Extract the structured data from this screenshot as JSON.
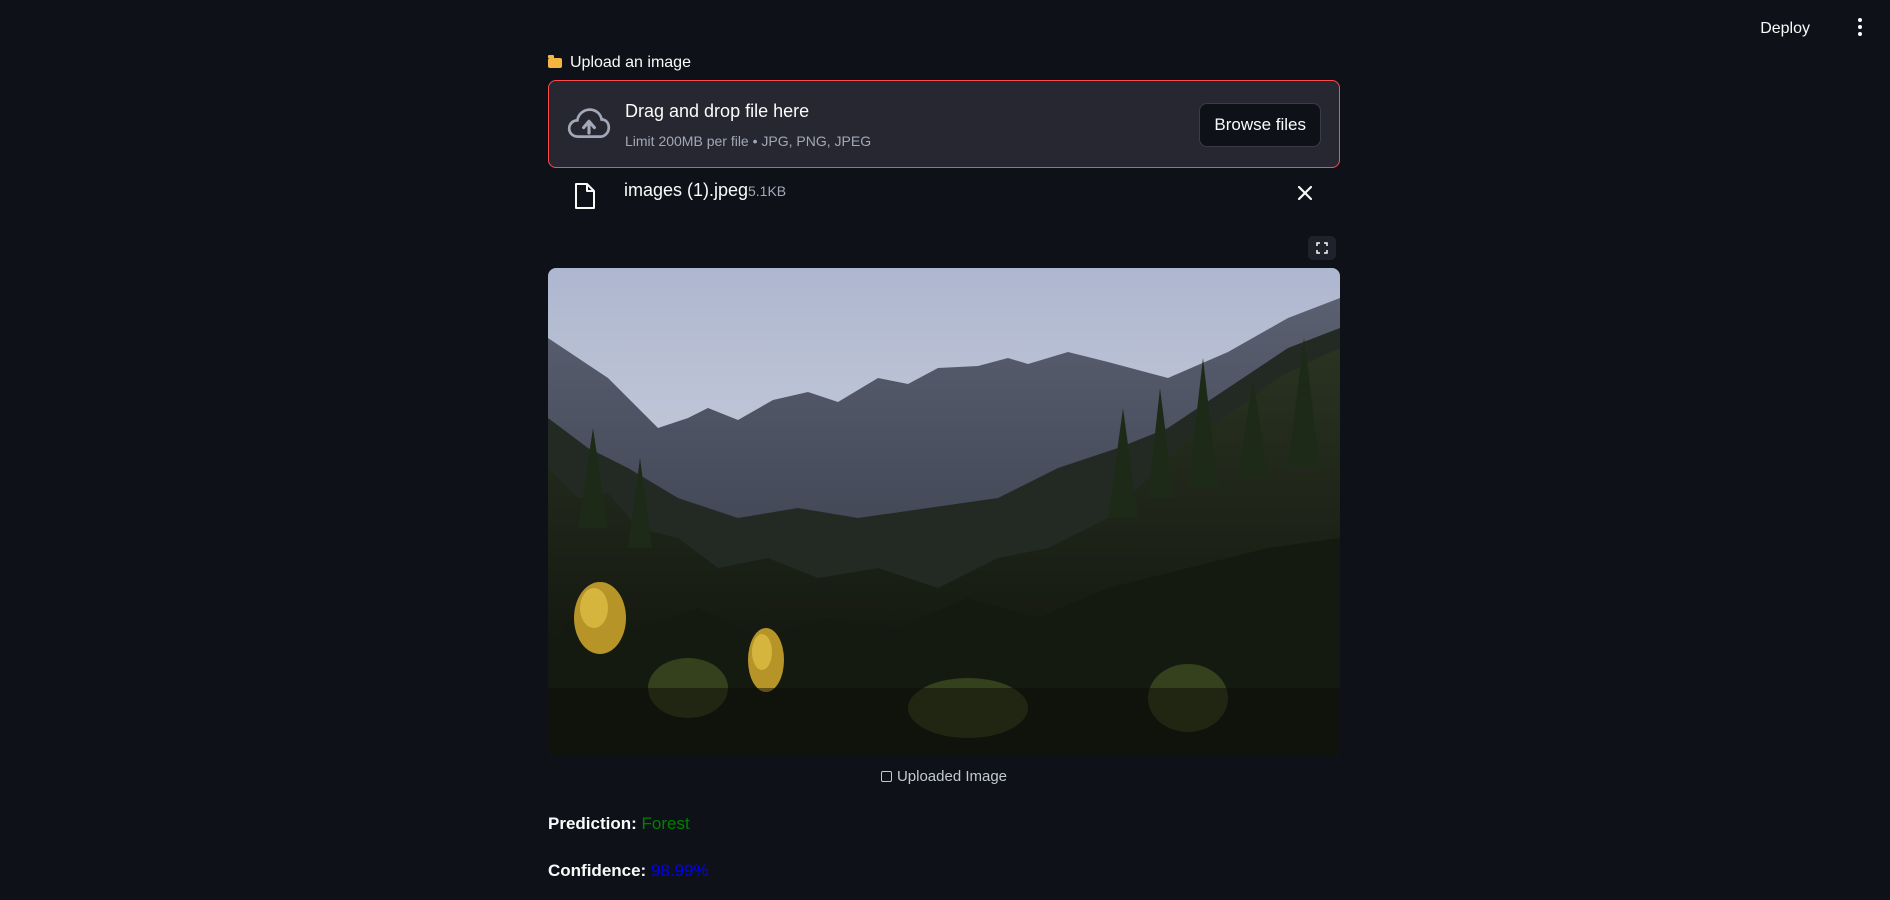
{
  "header": {
    "deploy_label": "Deploy"
  },
  "uploader": {
    "label": "Upload an image",
    "title": "Drag and drop file here",
    "subtitle": "Limit 200MB per file • JPG, PNG, JPEG",
    "browse_label": "Browse files"
  },
  "file": {
    "name": "images (1).jpeg",
    "size": "5.1KB"
  },
  "image": {
    "caption": "Uploaded Image"
  },
  "results": {
    "prediction_label": "Prediction:",
    "prediction_value": "Forest",
    "confidence_label": "Confidence:",
    "confidence_value": "98.99%"
  },
  "colors": {
    "background": "#0e1117",
    "accent_border": "#ff4b4b",
    "prediction": "#008000",
    "confidence": "#0000ff"
  }
}
